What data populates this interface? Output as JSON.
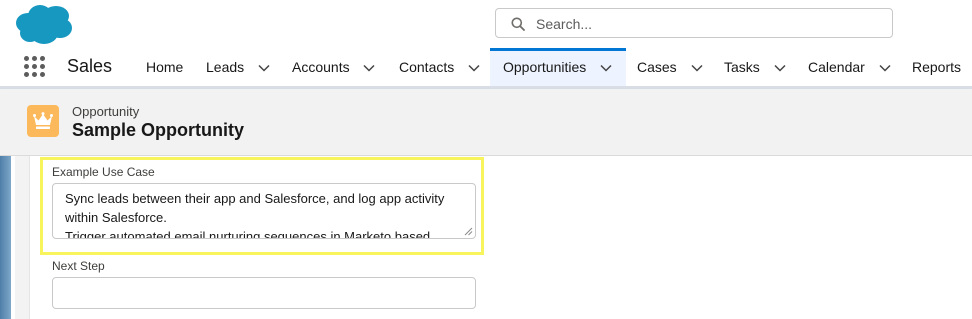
{
  "header": {
    "logo": "salesforce-cloud-logo",
    "search": {
      "placeholder": "Search...",
      "icon": "search-icon"
    }
  },
  "nav": {
    "app_name": "Sales",
    "items": [
      {
        "label": "Home",
        "dropdown": false
      },
      {
        "label": "Leads",
        "dropdown": true
      },
      {
        "label": "Accounts",
        "dropdown": true
      },
      {
        "label": "Contacts",
        "dropdown": true
      },
      {
        "label": "Opportunities",
        "dropdown": true,
        "active": true
      },
      {
        "label": "Cases",
        "dropdown": true
      },
      {
        "label": "Tasks",
        "dropdown": true
      },
      {
        "label": "Calendar",
        "dropdown": true
      },
      {
        "label": "Reports",
        "dropdown": false
      }
    ]
  },
  "record": {
    "type": "Opportunity",
    "name": "Sample Opportunity",
    "icon": "crown-icon"
  },
  "form": {
    "use_case_label": "Example Use Case",
    "use_case_value": "Sync leads between their app and Salesforce, and log app activity within Salesforce.\nTrigger automated email nurturing sequences in Marketo based",
    "next_step_label": "Next Step",
    "next_step_value": ""
  },
  "colors": {
    "brand_blue": "#0176d3",
    "logo_blue": "#1798c1",
    "opportunity_icon": "#fcb95b",
    "highlight": "#f8f55c"
  }
}
